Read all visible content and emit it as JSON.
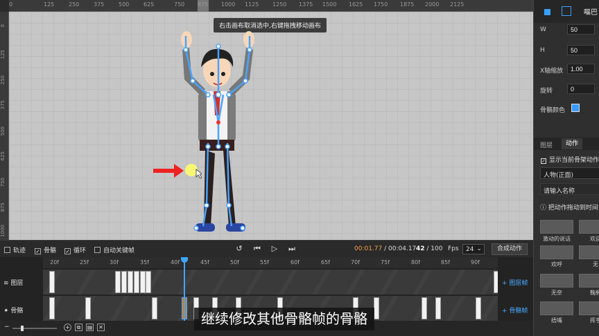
{
  "ruler": {
    "top_ticks": [
      "0",
      "125",
      "250",
      "375",
      "500",
      "625",
      "750",
      "875",
      "1000",
      "1125",
      "1250",
      "1375",
      "1500",
      "1625",
      "1750",
      "1875",
      "2000",
      "2125"
    ],
    "left_ticks": [
      "0",
      "125",
      "250",
      "375",
      "500",
      "625",
      "750",
      "875",
      "1000"
    ]
  },
  "canvas": {
    "tooltip": "右击画布取消选中,右键拖拽移动画布"
  },
  "properties": {
    "top_tab": "嘔巴",
    "w_label": "W",
    "w_value": "50",
    "h_label": "H",
    "h_value": "50",
    "xscale_label": "X轴缩放",
    "xscale_value": "1.00",
    "rotate_label": "旋转",
    "rotate_value": "0",
    "bone_color_label": "骨骼颜色",
    "bone_color": "#3a9bff"
  },
  "panel": {
    "tabs": [
      "图层",
      "动作"
    ],
    "active_tab": "动作",
    "show_action_label": "显示当前骨架动作",
    "character": "人物(正面)",
    "name_placeholder": "请输入名称",
    "hint": "把动作拖动到时间",
    "actions": [
      {
        "label": "激动的说话"
      },
      {
        "label": "欢迎"
      },
      {
        "label": "欢呼"
      },
      {
        "label": "无"
      },
      {
        "label": "无奈"
      },
      {
        "label": "鞠躬"
      },
      {
        "label": "捂嘴"
      },
      {
        "label": "挥手"
      }
    ]
  },
  "controls": {
    "track_label": "轨迹",
    "track_checked": false,
    "bone_label": "骨骼",
    "bone_checked": true,
    "loop_label": "循环",
    "loop_checked": true,
    "auto_key_label": "自动关键帧",
    "auto_key_checked": false,
    "current_time": "00:01.77",
    "total_time": "/ 00:04.17",
    "frame_current": "42",
    "frame_total": "/ 100",
    "fps_label": "Fps",
    "fps_value": "24",
    "compose_label": "合成动作"
  },
  "timeline": {
    "frame_labels": [
      "20f",
      "25f",
      "30f",
      "35f",
      "40f",
      "45f",
      "50f",
      "55f",
      "60f",
      "65f",
      "70f",
      "75f",
      "80f",
      "85f",
      "90f"
    ],
    "layer_track_label": "图层",
    "bone_track_label": "骨骼",
    "add_layer_frame": "+ 图层帧",
    "add_bone_frame": "+ 骨骼帧"
  },
  "subtitle": "继续修改其他骨骼帧的骨骼"
}
